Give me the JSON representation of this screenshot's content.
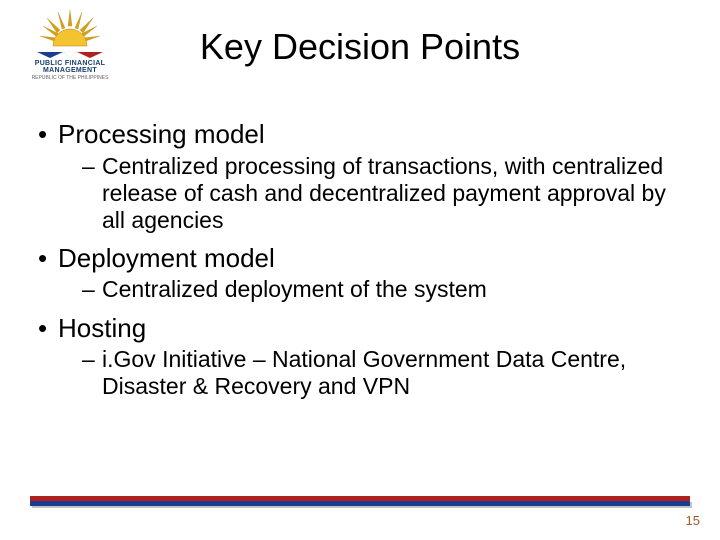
{
  "logo": {
    "main_text": "PUBLIC FINANCIAL MANAGEMENT",
    "sub_text": "REPUBLIC OF THE PHILIPPINES"
  },
  "title": "Key Decision Points",
  "bullets": [
    {
      "label": "Processing model",
      "sub": "Centralized processing of transactions, with centralized release of cash and decentralized payment approval by all agencies"
    },
    {
      "label": "Deployment model",
      "sub": "Centralized deployment of the system"
    },
    {
      "label": "Hosting",
      "sub": "i.Gov Initiative – National Government Data Centre, Disaster & Recovery and VPN"
    }
  ],
  "page_number": "15",
  "colors": {
    "red_bar": "#b02020",
    "blue_bar": "#1a3d8f"
  }
}
